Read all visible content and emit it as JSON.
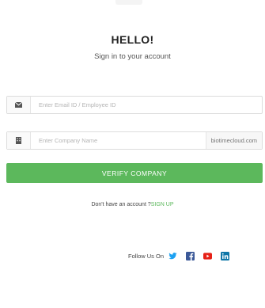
{
  "header": {
    "title": "HELLO!",
    "subtitle": "Sign in to your account"
  },
  "form": {
    "email": {
      "icon": "envelope-icon",
      "placeholder": "Enter Email ID / Employee ID",
      "value": ""
    },
    "company": {
      "icon": "building-icon",
      "placeholder": "Enter Company Name",
      "value": "",
      "suffix": "biotimecloud.com"
    },
    "verify_label": "VERIFY COMPANY"
  },
  "signup": {
    "prompt": "Don't have an account ?",
    "link": "SIGN UP"
  },
  "social": {
    "label": "Follow Us On",
    "icons": [
      "twitter-icon",
      "facebook-icon",
      "youtube-icon",
      "linkedin-icon"
    ]
  },
  "colors": {
    "accent_green": "#5cb85c",
    "twitter": "#1da1f2",
    "facebook": "#3b5998",
    "youtube": "#e62117",
    "linkedin": "#0e76a8"
  }
}
